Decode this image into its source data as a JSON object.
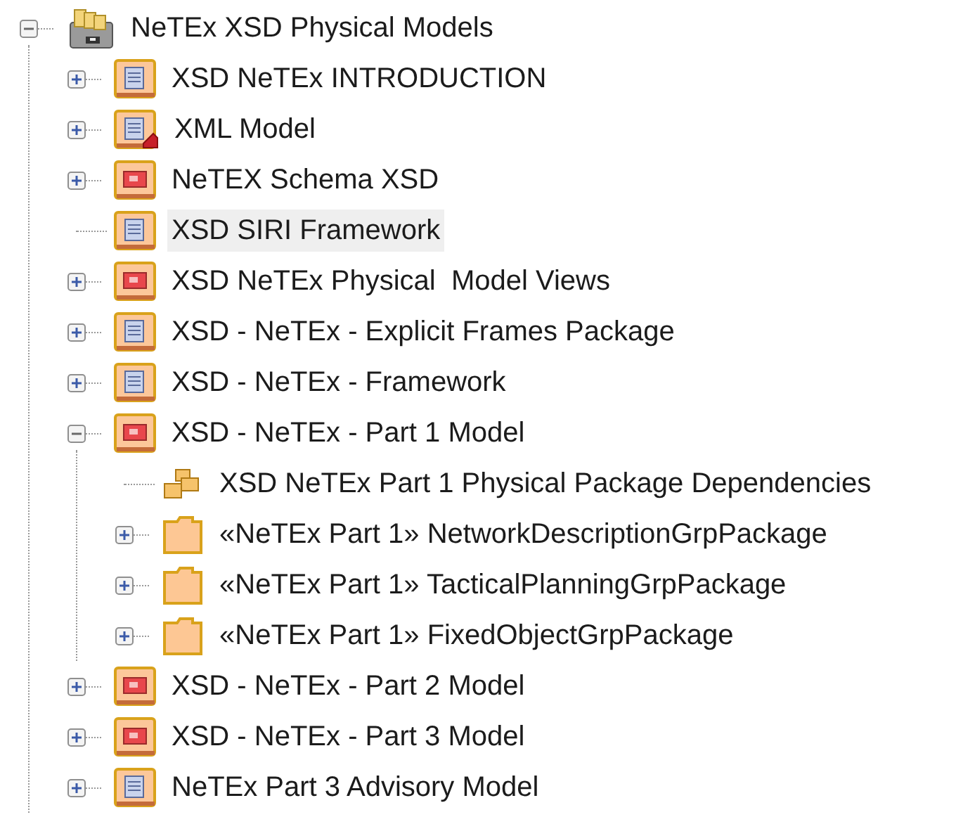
{
  "tree": {
    "label": "NeTEx XSD Physical Models",
    "kind": "repository",
    "expanded": true,
    "selected": false,
    "children": [
      {
        "label": "XSD NeTEx INTRODUCTION",
        "kind": "model",
        "expanded": false,
        "selected": false
      },
      {
        "label": "XML Model",
        "kind": "xml-model",
        "expanded": false,
        "selected": false
      },
      {
        "label": "NeTEX Schema XSD",
        "kind": "view",
        "expanded": false,
        "selected": false
      },
      {
        "label": "XSD SIRI Framework",
        "kind": "model",
        "selected": true
      },
      {
        "label": "XSD NeTEx Physical  Model Views",
        "kind": "view",
        "expanded": false,
        "selected": false
      },
      {
        "label": "XSD - NeTEx - Explicit Frames Package",
        "kind": "model",
        "expanded": false,
        "selected": false
      },
      {
        "label": "XSD - NeTEx - Framework",
        "kind": "model",
        "expanded": false,
        "selected": false
      },
      {
        "label": "XSD - NeTEx - Part 1 Model",
        "kind": "view",
        "expanded": true,
        "selected": false,
        "children": [
          {
            "label": "XSD NeTEx Part 1 Physical Package Dependencies",
            "kind": "diagram",
            "selected": false
          },
          {
            "label": "«NeTEx Part 1» NetworkDescriptionGrpPackage",
            "kind": "package",
            "expanded": false,
            "selected": false
          },
          {
            "label": "«NeTEx Part 1» TacticalPlanningGrpPackage",
            "kind": "package",
            "expanded": false,
            "selected": false
          },
          {
            "label": "«NeTEx Part 1» FixedObjectGrpPackage",
            "kind": "package",
            "expanded": false,
            "selected": false
          }
        ]
      },
      {
        "label": "XSD - NeTEx - Part 2 Model",
        "kind": "view",
        "expanded": false,
        "selected": false
      },
      {
        "label": "XSD - NeTEx - Part 3 Model",
        "kind": "view",
        "expanded": false,
        "selected": false
      },
      {
        "label": "NeTEx Part 3 Advisory Model",
        "kind": "model",
        "expanded": false,
        "selected": false
      }
    ]
  }
}
